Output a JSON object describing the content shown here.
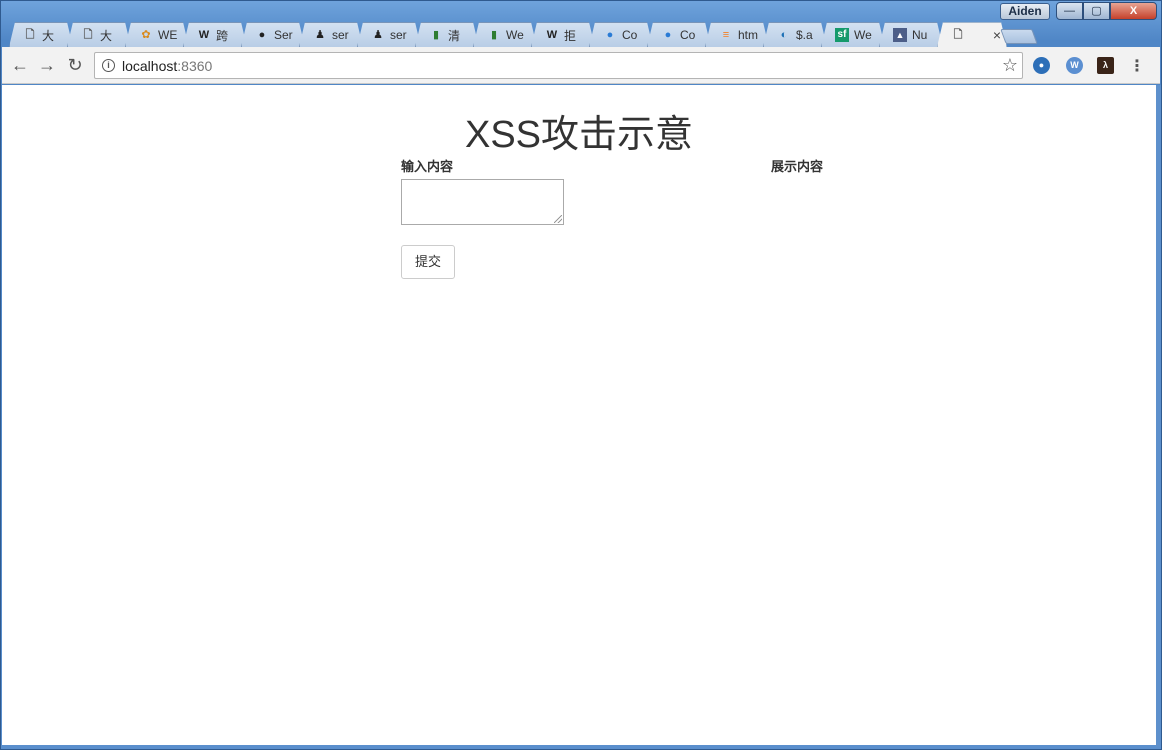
{
  "window": {
    "profile_name": "Aiden",
    "minimize": "—",
    "maximize": "▢",
    "close": "X"
  },
  "tabs": [
    {
      "label": "大",
      "icon": "page-icon",
      "glyph": "🗋",
      "color": "#555"
    },
    {
      "label": "大",
      "icon": "page-icon",
      "glyph": "🗋",
      "color": "#555"
    },
    {
      "label": "WE",
      "icon": "orange-logo-icon",
      "glyph": "✿",
      "color": "#d98a1c"
    },
    {
      "label": "跨",
      "icon": "wikipedia-icon",
      "glyph": "W",
      "color": "#222"
    },
    {
      "label": "Ser",
      "icon": "github-icon",
      "glyph": "●",
      "color": "#222"
    },
    {
      "label": "ser",
      "icon": "person-logo-icon",
      "glyph": "♟",
      "color": "#222"
    },
    {
      "label": "ser",
      "icon": "person-logo-icon",
      "glyph": "♟",
      "color": "#222"
    },
    {
      "label": "清",
      "icon": "mdn-icon",
      "glyph": "▮",
      "color": "#2e7d32"
    },
    {
      "label": "We",
      "icon": "mdn-icon",
      "glyph": "▮",
      "color": "#2e7d32"
    },
    {
      "label": "拒",
      "icon": "wikipedia-icon",
      "glyph": "W",
      "color": "#222"
    },
    {
      "label": "Co",
      "icon": "blue-circle-icon",
      "glyph": "●",
      "color": "#2a7bd5"
    },
    {
      "label": "Co",
      "icon": "blue-circle-icon",
      "glyph": "●",
      "color": "#2a7bd5"
    },
    {
      "label": "htm",
      "icon": "stackoverflow-icon",
      "glyph": "≡",
      "color": "#f48024"
    },
    {
      "label": "$.a",
      "icon": "jquery-icon",
      "glyph": "◐",
      "color": "#1b6fb5"
    },
    {
      "label": "We",
      "icon": "segmentfault-icon",
      "glyph": "sf",
      "color": "#fff"
    },
    {
      "label": "Nu",
      "icon": "triangle-logo-icon",
      "glyph": "▲",
      "color": "#fff"
    },
    {
      "label": "",
      "icon": "page-icon",
      "glyph": "🗋",
      "color": "#555",
      "active": true
    }
  ],
  "active_tab_close": "×",
  "toolbar": {
    "back": "←",
    "forward": "→",
    "reload": "↻",
    "url_host": "localhost",
    "url_port": ":8360",
    "star": "☆",
    "menu": "⋮"
  },
  "page": {
    "title": "XSS攻击示意",
    "input_label": "输入内容",
    "display_label": "展示内容",
    "textarea_value": "",
    "submit_label": "提交"
  }
}
